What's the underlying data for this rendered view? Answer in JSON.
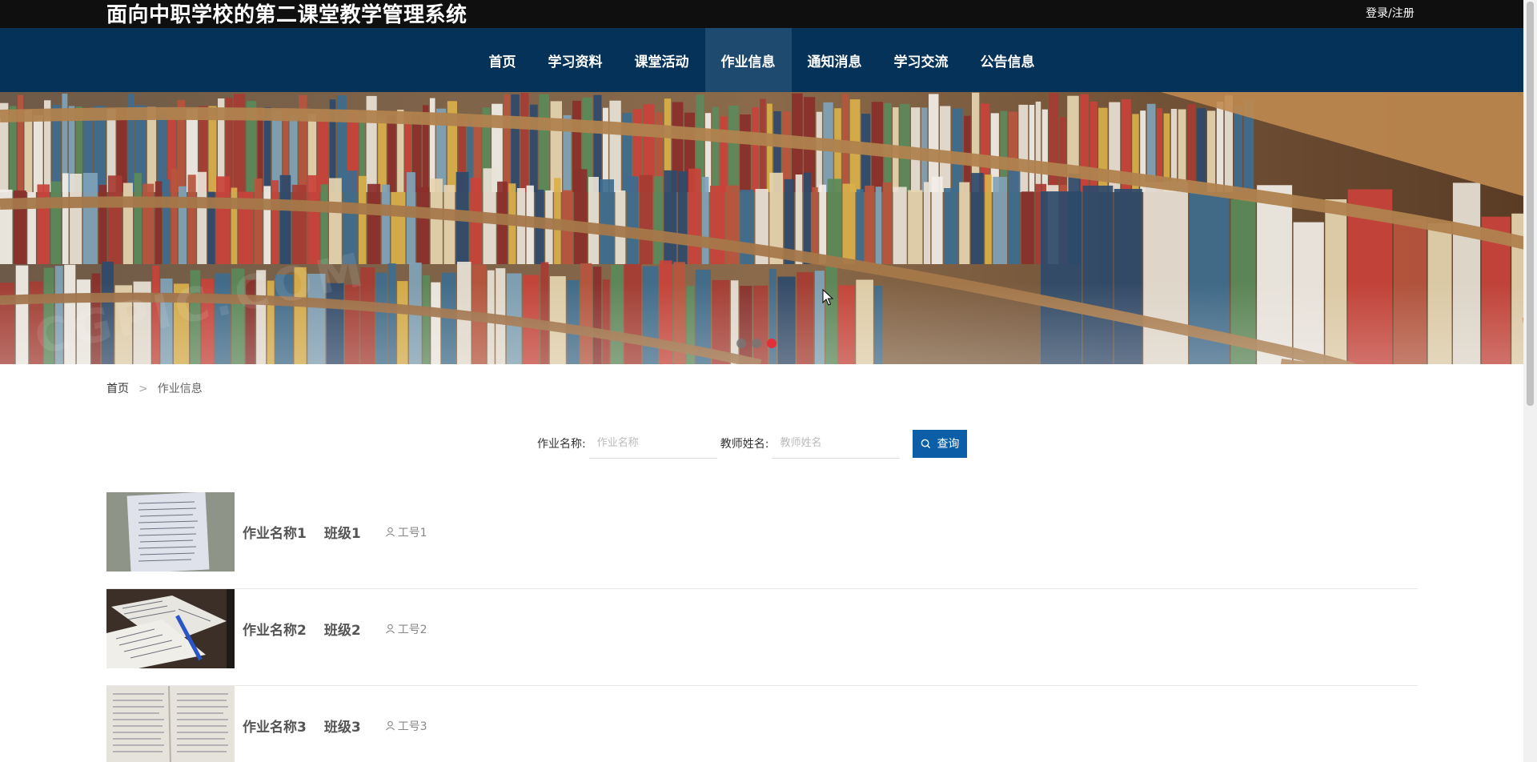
{
  "header": {
    "site_title": "面向中职学校的第二课堂教学管理系统",
    "login_label": "登录/注册"
  },
  "nav": {
    "items": [
      {
        "label": "首页",
        "active": false
      },
      {
        "label": "学习资料",
        "active": false
      },
      {
        "label": "课堂活动",
        "active": false
      },
      {
        "label": "作业信息",
        "active": true
      },
      {
        "label": "通知消息",
        "active": false
      },
      {
        "label": "学习交流",
        "active": false
      },
      {
        "label": "公告信息",
        "active": false
      }
    ]
  },
  "banner": {
    "slide_count": 3,
    "active_slide": 3,
    "watermark": "CGPIC.COM"
  },
  "breadcrumb": {
    "home": "首页",
    "separator": ">",
    "current": "作业信息"
  },
  "search": {
    "homework_label": "作业名称:",
    "homework_placeholder": "作业名称",
    "teacher_label": "教师姓名:",
    "teacher_placeholder": "教师姓名",
    "button_label": "查询"
  },
  "homework_list": [
    {
      "name": "作业名称1",
      "class_name": "班级1",
      "teacher_id": "工号1",
      "thumb": "handwritten-notebook"
    },
    {
      "name": "作业名称2",
      "class_name": "班级2",
      "teacher_id": "工号2",
      "thumb": "open-workbook-with-pen"
    },
    {
      "name": "作业名称3",
      "class_name": "班级3",
      "teacher_id": "工号3",
      "thumb": "handwritten-pages"
    }
  ],
  "colors": {
    "topbar": "#0f0f0f",
    "navbar": "#053258",
    "nav_active": "#1d4a6e",
    "search_button": "#0c5fa6",
    "active_dot": "#e0313a"
  }
}
